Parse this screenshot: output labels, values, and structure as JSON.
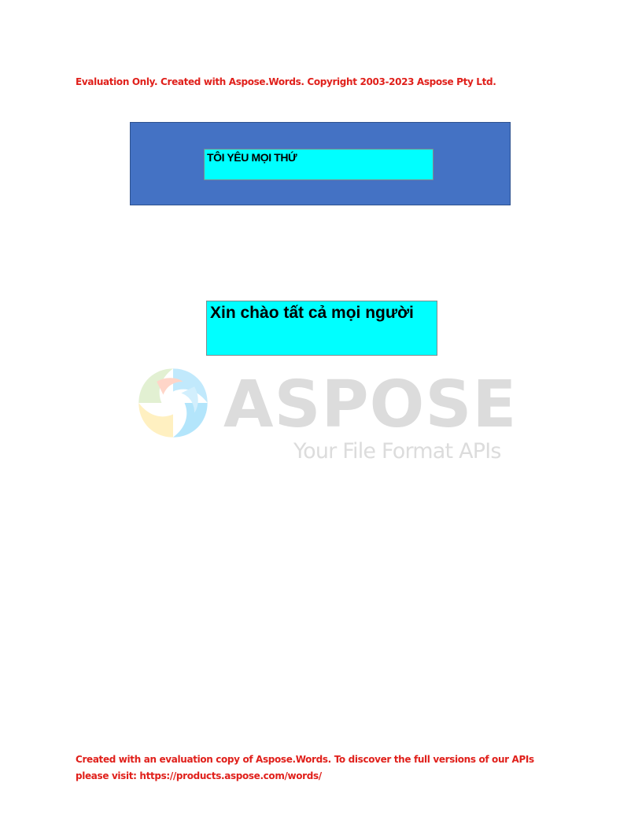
{
  "header": {
    "evaluation_notice": "Evaluation Only. Created with Aspose.Words. Copyright 2003-2023 Aspose Pty Ltd."
  },
  "shapes": {
    "box1_text": "TÔI YÊU MỌI THỨ",
    "box2_text": "Xin chào tất cả mọi người"
  },
  "watermark": {
    "word": "ASPOSE",
    "tagline": "Your File Format APIs",
    "logo_icon": "aspose-swirl-icon"
  },
  "footer": {
    "line1": "Created with an evaluation copy of Aspose.Words. To discover the full versions of our APIs",
    "line2": "please visit: https://products.aspose.com/words/"
  },
  "colors": {
    "notice_red": "#e0201b",
    "blue_fill": "#4472c4",
    "cyan_fill": "#00ffff"
  }
}
